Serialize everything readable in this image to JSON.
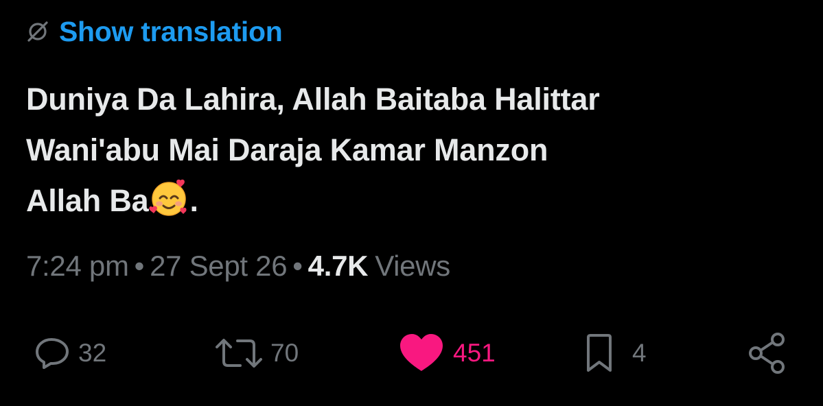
{
  "translation": {
    "label": "Show translation",
    "icon": "no-translate-icon",
    "color": "#1d9bf0"
  },
  "post": {
    "text_line1": "Duniya Da Lahira, Allah Baitaba Halittar",
    "text_line2": "Wani'abu Mai Daraja Kamar Manzon",
    "text_line3_before": "Allah Ba",
    "emoji": "smiling-face-with-hearts",
    "text_line3_after": "."
  },
  "meta": {
    "time": "7:24 pm",
    "separator": "•",
    "date": "27 Sept 26",
    "views_count": "4.7K",
    "views_label": "Views"
  },
  "actions": {
    "replies": {
      "icon": "reply-icon",
      "count": "32"
    },
    "reposts": {
      "icon": "repost-icon",
      "count": "70"
    },
    "likes": {
      "icon": "heart-icon",
      "count": "451",
      "liked": true,
      "color": "#f91880"
    },
    "bookmarks": {
      "icon": "bookmark-icon",
      "count": "4"
    },
    "share": {
      "icon": "share-icon"
    }
  }
}
